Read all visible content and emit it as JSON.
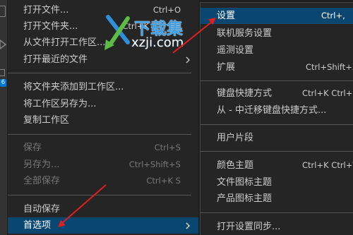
{
  "colors": {
    "menu_bg": "#252526",
    "selected_bg": "#094771",
    "annotation_arrow": "#e02020",
    "badge": "#0078d4",
    "watermark_title": "#3fa0e6",
    "watermark_green": "#5dbb46"
  },
  "activity_bar": {
    "icons": [
      "files-icon",
      "run-debug-icon",
      "extensions-icon"
    ],
    "extensions_badge": "6"
  },
  "file_menu": {
    "items": [
      {
        "label": "打开文件...",
        "shortcut": "Ctrl+O"
      },
      {
        "label": "打开文件夹...",
        "shortcut": "Ctrl+K"
      },
      {
        "label": "从文件打开工作区..."
      },
      {
        "label": "打开最近的文件",
        "submenu": true,
        "icon": "chevron-right-icon"
      },
      {
        "label": "将文件夹添加到工作区..."
      },
      {
        "label": "将工作区另存为..."
      },
      {
        "label": "复制工作区"
      },
      {
        "label": "保存",
        "shortcut": "Ctrl+S",
        "disabled": true
      },
      {
        "label": "另存为...",
        "shortcut": "Ctrl+Shift+S",
        "disabled": true
      },
      {
        "label": "全部保存",
        "shortcut": "Ctrl+K S",
        "disabled": true
      },
      {
        "label": "自动保存"
      },
      {
        "label": "首选项",
        "submenu": true,
        "selected": true,
        "icon": "chevron-right-icon"
      }
    ]
  },
  "preferences_submenu": {
    "items": [
      {
        "label": "设置",
        "shortcut": "Ctrl+,",
        "selected": true
      },
      {
        "label": "联机服务设置"
      },
      {
        "label": "遥测设置"
      },
      {
        "label": "扩展",
        "shortcut": "Ctrl+Shift+X"
      },
      {
        "label": "键盘快捷方式",
        "shortcut": "Ctrl+K Ctrl+S"
      },
      {
        "label": "从 - 中迁移键盘快捷方式..."
      },
      {
        "label": "用户片段"
      },
      {
        "label": "颜色主题",
        "shortcut": "Ctrl+K Ctrl+T"
      },
      {
        "label": "文件图标主题"
      },
      {
        "label": "产品图标主题"
      },
      {
        "label": "打开设置同步..."
      }
    ]
  },
  "watermark": {
    "icon": "xzji-logo-icon",
    "title": "下载集",
    "domain": "xzji.com"
  }
}
